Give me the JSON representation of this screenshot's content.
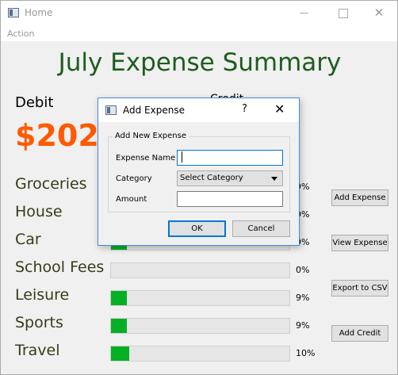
{
  "window": {
    "title": "Home",
    "icon": "app-window-icon",
    "controls": {
      "minimize": "",
      "maximize": "",
      "close": "✕"
    }
  },
  "menu": {
    "items": [
      "Action"
    ]
  },
  "summary": {
    "title": "July Expense Summary",
    "debit_label": "Debit",
    "credit_label": "Credit",
    "debit_amount": "$202",
    "debit_color": "#ff5a00",
    "title_color": "#1e5c1e"
  },
  "categories": [
    {
      "label": "Groceries",
      "percent": 9,
      "percent_text": "9%"
    },
    {
      "label": "House",
      "percent": 9,
      "percent_text": "9%"
    },
    {
      "label": "Car",
      "percent": 9,
      "percent_text": "9%"
    },
    {
      "label": "School Fees",
      "percent": 0,
      "percent_text": "0%"
    },
    {
      "label": "Leisure",
      "percent": 9,
      "percent_text": "9%"
    },
    {
      "label": "Sports",
      "percent": 9,
      "percent_text": "9%"
    },
    {
      "label": "Travel",
      "percent": 10,
      "percent_text": "10%"
    }
  ],
  "progress_color": "#06b025",
  "side_buttons": {
    "add_expense": "Add Expense",
    "view_expense": "View Expense",
    "export_csv": "Export to CSV",
    "add_credit": "Add Credit"
  },
  "dialog": {
    "title": "Add Expense",
    "help": "?",
    "close": "✕",
    "group_title": "Add New Expense",
    "expense_name_label": "Expense Name",
    "expense_name_value": "",
    "category_label": "Category",
    "category_selected": "Select Category",
    "amount_label": "Amount",
    "amount_value": "",
    "ok_label": "OK",
    "cancel_label": "Cancel"
  }
}
